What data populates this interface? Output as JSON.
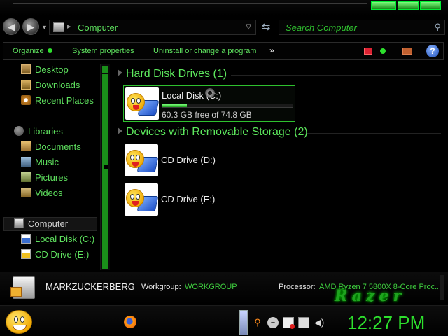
{
  "address": {
    "path": "Computer"
  },
  "search": {
    "placeholder": "Search Computer"
  },
  "command_bar": {
    "organize": "Organize",
    "system_properties": "System properties",
    "uninstall": "Uninstall or change a program",
    "more": "»"
  },
  "sidebar": {
    "favorites": [
      {
        "label": "Desktop",
        "icon": "desktop-icon"
      },
      {
        "label": "Downloads",
        "icon": "downloads-icon"
      },
      {
        "label": "Recent Places",
        "icon": "recent-places-icon"
      }
    ],
    "libraries": {
      "label": "Libraries",
      "items": [
        {
          "label": "Documents",
          "icon": "documents-icon"
        },
        {
          "label": "Music",
          "icon": "music-icon"
        },
        {
          "label": "Pictures",
          "icon": "pictures-icon"
        },
        {
          "label": "Videos",
          "icon": "videos-icon"
        }
      ]
    },
    "computer": {
      "label": "Computer",
      "items": [
        {
          "label": "Local Disk (C:)",
          "icon": "hard-disk-icon"
        },
        {
          "label": "CD Drive (E:)",
          "icon": "cd-drive-icon"
        }
      ]
    }
  },
  "content": {
    "hard_disk_header": "Hard Disk Drives (1)",
    "removable_header": "Devices with Removable Storage (2)",
    "local_disk": {
      "name": "Local Disk (C:)",
      "free_text": "60.3 GB free of 74.8 GB",
      "used_fraction": 0.19
    },
    "cd_d": {
      "name": "CD Drive (D:)"
    },
    "cd_e": {
      "name": "CD Drive (E:)"
    }
  },
  "details": {
    "computer_name": "MARKZUCKERBERG",
    "workgroup_label": "Workgroup:",
    "workgroup_value": "WORKGROUP",
    "processor_label": "Processor:",
    "processor_value": "AMD Ryzen 7 5800X 8-Core Proc...",
    "logo_text": "Razer"
  },
  "taskbar": {
    "clock": "12:27 PM"
  },
  "colors": {
    "accent": "#2de02d",
    "background": "#000000"
  }
}
